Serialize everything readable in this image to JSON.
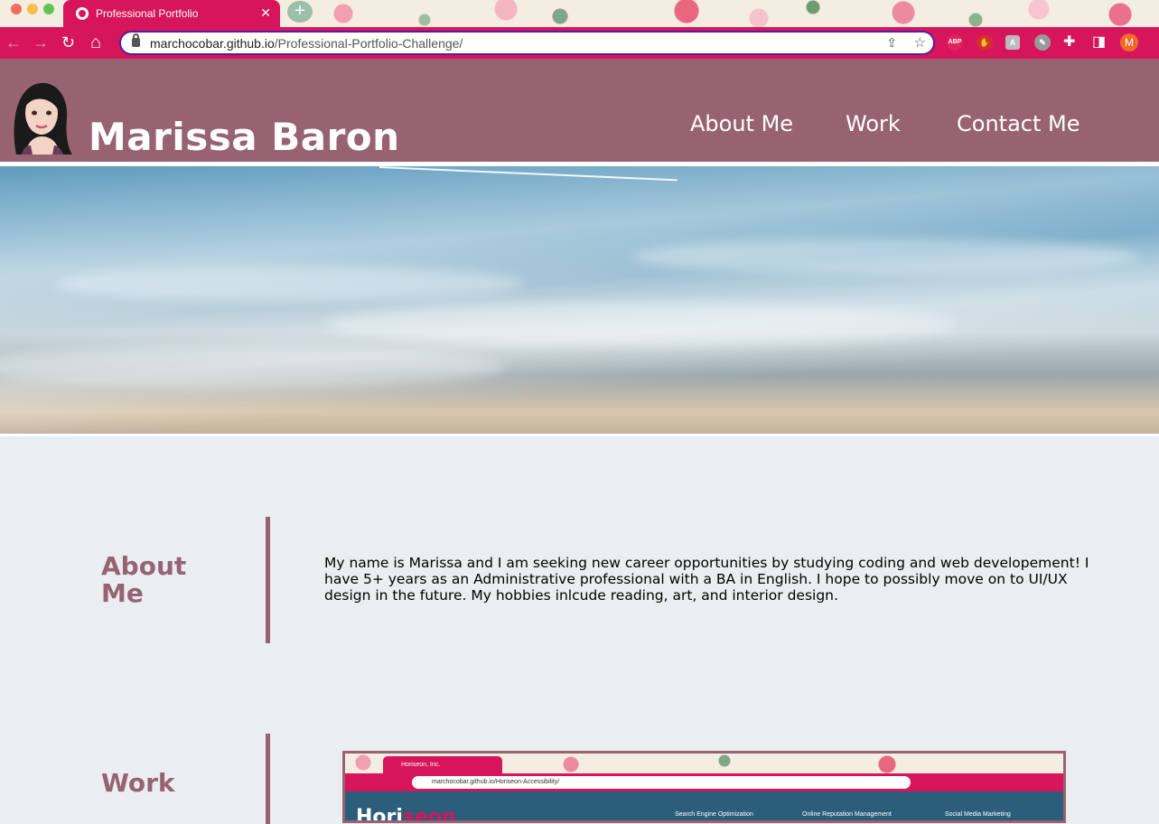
{
  "browser": {
    "tab_title": "Professional Portfolio",
    "tab_close": "✕",
    "new_tab": "+",
    "url_domain": "marchocobar.github.io",
    "url_path": "/Professional-Portfolio-Challenge/",
    "nav_back": "←",
    "nav_forward": "→",
    "nav_reload": "↻",
    "nav_home": "⌂",
    "extensions": [
      "ABP",
      "✋",
      "A",
      "✎"
    ],
    "profile_initial": "M",
    "accent_color": "#d6155a"
  },
  "site": {
    "title": "Marissa Baron",
    "nav": [
      "About Me",
      "Work",
      "Contact Me"
    ],
    "brand_color": "#976373"
  },
  "about": {
    "heading_line1": "About",
    "heading_line2": "Me",
    "body": "My name is Marissa and I am seeking new career opportunities by studying coding and web developement! I have 5+ years as an Administrative professional with a BA in English. I hope to possibly move on to UI/UX design in the future. My hobbies inlcude reading, art, and interior design."
  },
  "work": {
    "heading": "Work",
    "screenshot": {
      "tab_title": "Horiseon, Inc.",
      "url": "marchocobar.github.io/Horiseon-Accessibility/",
      "logo_main": "Hori",
      "logo_accent": "seon",
      "nav": [
        "Search Engine Optimization",
        "Online Reputation Management",
        "Social Media Marketing"
      ]
    }
  }
}
